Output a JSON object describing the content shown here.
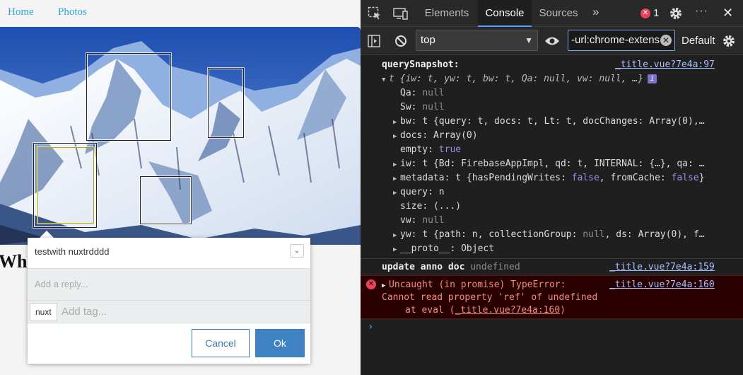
{
  "page": {
    "nav": {
      "home": "Home",
      "photos": "Photos"
    },
    "heading": "Wh",
    "annotation": {
      "text": "testwith nuxtrdddd",
      "reply_placeholder": "Add a reply...",
      "tag": "nuxt",
      "tag_placeholder": "Add tag...",
      "cancel": "Cancel",
      "ok": "Ok"
    }
  },
  "devtools": {
    "tabs": [
      "Elements",
      "Console",
      "Sources"
    ],
    "active_tab": "Console",
    "error_count": "1",
    "context": "top",
    "filter_value": "-url:chrome-extens",
    "levels": "Default",
    "log": {
      "label": "querySnapshot:",
      "source": "_title.vue?7e4a:97",
      "summary_prefix": "t {iw: t, yw: t, bw: t, Qa: null, vw: null, …}",
      "props": [
        {
          "key": "Qa",
          "value": "null",
          "kind": "nul",
          "expandable": false
        },
        {
          "key": "Sw",
          "value": "null",
          "kind": "nul",
          "expandable": false
        },
        {
          "key": "bw",
          "value": "t {query: t, docs: t, Lt: t, docChanges: Array(0),…",
          "kind": "plain",
          "expandable": true
        },
        {
          "key": "docs",
          "value": "Array(0)",
          "kind": "plain",
          "expandable": true
        },
        {
          "key": "empty",
          "value": "true",
          "kind": "kw",
          "expandable": false
        },
        {
          "key": "iw",
          "value": "t {Bd: FirebaseAppImpl, qd: t, INTERNAL: {…}, qa: …",
          "kind": "plain",
          "expandable": true
        },
        {
          "key": "metadata",
          "value": "t {hasPendingWrites: false, fromCache: false}",
          "kind": "plain",
          "expandable": true
        },
        {
          "key": "query",
          "value": "n",
          "kind": "plain",
          "expandable": true
        },
        {
          "key": "size",
          "value": "(...)",
          "kind": "plain",
          "expandable": false
        },
        {
          "key": "vw",
          "value": "null",
          "kind": "nul",
          "expandable": false
        },
        {
          "key": "yw",
          "value": "t {path: n, collectionGroup: null, ds: Array(0), f…",
          "kind": "plain",
          "expandable": true
        },
        {
          "key": "__proto__",
          "value": "Object",
          "kind": "plain",
          "expandable": true
        }
      ]
    },
    "log2": {
      "label": "update anno doc",
      "value": "undefined",
      "source": "_title.vue?7e4a:159"
    },
    "error": {
      "line1": "Uncaught (in promise) TypeError:",
      "line2": "Cannot read property 'ref' of undefined",
      "line3_prefix": "at eval (",
      "line3_link": "_title.vue?7e4a:160",
      "line3_suffix": ")",
      "source": "_title.vue?7e4a:160"
    }
  }
}
